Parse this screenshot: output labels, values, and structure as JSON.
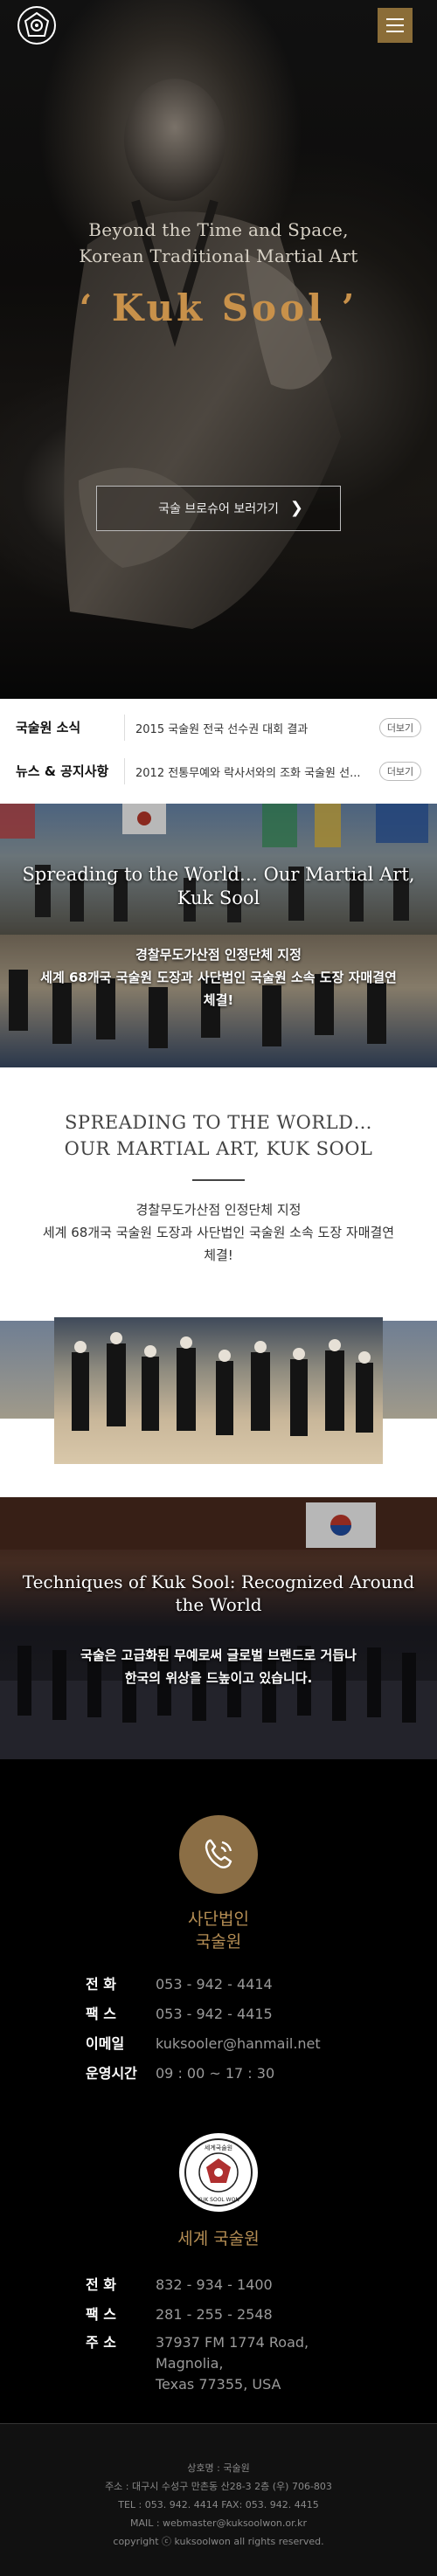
{
  "header": {
    "logo_icon": "kuksool-emblem-icon",
    "menu_icon": "hamburger-menu-icon",
    "menu_color": "#8b6d38"
  },
  "hero": {
    "subtitle_line1": "Beyond the Time and Space,",
    "subtitle_line2": "Korean Traditional Martial Art",
    "title": "‘ Kuk Sool ’",
    "title_color": "#c8914a",
    "button_label": "국술 브로슈어 보러가기",
    "button_icon": "chevron-right-icon"
  },
  "news": {
    "rows": [
      {
        "category": "국술원 소식",
        "title": "2015 국술원 전국 선수권 대회 결과",
        "more": "더보기"
      },
      {
        "category": "뉴스 & 공지사항",
        "title": "2012 전통무예와 락사서와의 조화 국술원 선...",
        "more": "더보기"
      }
    ]
  },
  "banner1": {
    "title": "Spreading to the World… Our Martial Art, Kuk Sool",
    "text_line1": "경찰무도가산점 인정단체 지정",
    "text_line2": "세계 68개국 국술원 도장과 사단법인 국술원 소속 도장 자매결연",
    "text_line3": "체결!"
  },
  "section": {
    "title_line1": "SPREADING TO THE WORLD…",
    "title_line2": "OUR MARTIAL ART, KUK SOOL",
    "text_line1": "경찰무도가산점 인정단체 지정",
    "text_line2": "세계 68개국 국술원 도장과 사단법인 국술원 소속 도장 자매결연",
    "text_line3": "체결!"
  },
  "banner2": {
    "title": "Techniques of Kuk Sool: Recognized Around the World",
    "text_line1": "국술은 고급화된 무예로써 글로벌 브랜드로 거듭나",
    "text_line2": "한국의 위상을 드높이고 있습니다."
  },
  "contact": {
    "phone_icon": "phone-icon",
    "accent_color": "#b58e54",
    "org1_line1": "사단법인",
    "org1_line2": "국술원",
    "org1_rows": [
      {
        "label": "전 화",
        "value": "053 - 942 - 4414"
      },
      {
        "label": "팩 스",
        "value": "053 - 942 - 4415"
      },
      {
        "label": "이메일",
        "value": "kuksooler@hanmail.net"
      },
      {
        "label": "운영시간",
        "value": "09 : 00 ~ 17 : 30"
      }
    ],
    "emblem_icon": "world-kuksool-emblem-icon",
    "emblem_top_text": "세계국술원",
    "emblem_bottom_text": "KUK SOOL WON",
    "org2_title": "세계 국술원",
    "org2_rows": [
      {
        "label": "전 화",
        "value": "832 - 934 - 1400"
      },
      {
        "label": "팩 스",
        "value": "281 - 255 - 2548"
      },
      {
        "label": "주 소",
        "value_line1": "37937 FM 1774 Road,",
        "value_line2": "Magnolia,",
        "value_line3": "Texas 77355, USA"
      }
    ]
  },
  "footer": {
    "line1": "상호명 : 국술원",
    "line2": "주소 : 대구시 수성구 만촌동 산28-3 2층 (우) 706-803",
    "line3": "TEL : 053. 942. 4414 FAX: 053. 942. 4415",
    "line4": "MAIL : webmaster@kuksoolwon.or.kr",
    "line5": "copyright ⓒ kuksoolwon all rights reserved."
  }
}
